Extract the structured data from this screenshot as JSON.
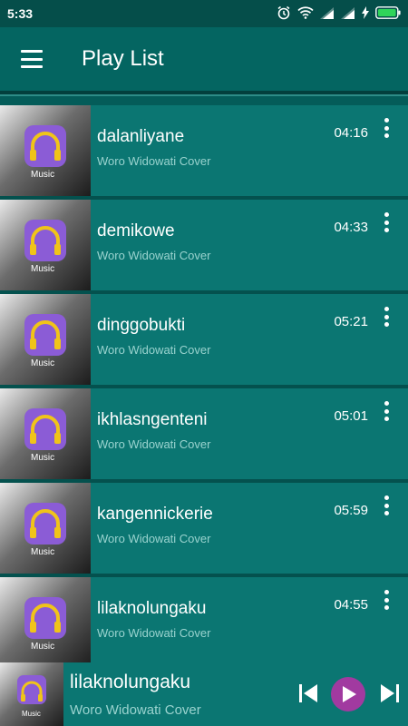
{
  "status_bar": {
    "time": "5:33",
    "icons": [
      "alarm-icon",
      "wifi-icon",
      "signal-icon",
      "signal-icon",
      "charging-icon",
      "battery-icon"
    ]
  },
  "header": {
    "menu_icon": "hamburger-menu-icon",
    "title": "Play List"
  },
  "colors": {
    "header": "#046561",
    "status_bar": "#054e4a",
    "list_item": "#0b7672",
    "accent_play": "#a13aa0",
    "app_icon": "#8b5cd6",
    "headphone": "#f0c419"
  },
  "tracks": [
    {
      "title": "dalanliyane",
      "artist": "Woro Widowati Cover",
      "duration": "04:16",
      "thumb_label": "Music"
    },
    {
      "title": "demikowe",
      "artist": "Woro Widowati Cover",
      "duration": "04:33",
      "thumb_label": "Music"
    },
    {
      "title": "dinggobukti",
      "artist": "Woro Widowati Cover",
      "duration": "05:21",
      "thumb_label": "Music"
    },
    {
      "title": "ikhlasngenteni",
      "artist": "Woro Widowati Cover",
      "duration": "05:01",
      "thumb_label": "Music"
    },
    {
      "title": "kangennickerie",
      "artist": "Woro Widowati Cover",
      "duration": "05:59",
      "thumb_label": "Music"
    },
    {
      "title": "lilaknolungaku",
      "artist": "Woro Widowati Cover",
      "duration": "04:55",
      "thumb_label": "Music"
    }
  ],
  "now_playing": {
    "title": "lilaknolungaku",
    "artist": "Woro Widowati Cover",
    "thumb_label": "Music",
    "controls": [
      "skip-previous-icon",
      "play-icon",
      "skip-next-icon"
    ]
  }
}
